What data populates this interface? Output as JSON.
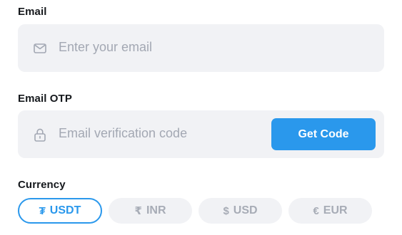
{
  "email": {
    "label": "Email",
    "placeholder": "Enter your email"
  },
  "otp": {
    "label": "Email OTP",
    "placeholder": "Email verification code",
    "button_label": "Get Code"
  },
  "currency": {
    "label": "Currency",
    "options": [
      {
        "symbol": "₮",
        "code": "USDT",
        "selected": true
      },
      {
        "symbol": "₹",
        "code": "INR",
        "selected": false
      },
      {
        "symbol": "$",
        "code": "USD",
        "selected": false
      },
      {
        "symbol": "€",
        "code": "EUR",
        "selected": false
      }
    ]
  },
  "colors": {
    "accent": "#2a98ec",
    "field_bg": "#f1f2f5",
    "placeholder": "#a3a8b3"
  },
  "icons": {
    "email_field": "mail-icon",
    "otp_field": "lock-icon"
  }
}
